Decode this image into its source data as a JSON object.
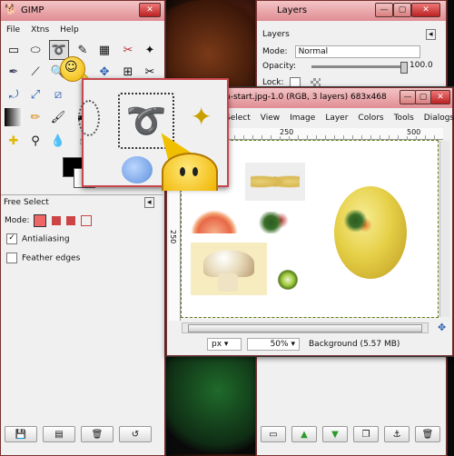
{
  "toolbox": {
    "title": "GIMP",
    "menu": [
      "File",
      "Xtns",
      "Help"
    ],
    "dock_title": "Free Select",
    "mode_label": "Mode:",
    "antialiasing_label": "Antialiasing",
    "feather_label": "Feather edges",
    "antialiasing_checked": true,
    "feather_checked": false
  },
  "layers": {
    "title": "Layers",
    "heading": "Layers",
    "mode_label": "Mode:",
    "mode_value": "Normal",
    "opacity_label": "Opacity:",
    "opacity_value": "100.0",
    "opacity_level": 1.0,
    "lock_label": "Lock:"
  },
  "image_window": {
    "title": "n-start.jpg-1.0 (RGB, 3 layers) 683x468",
    "menu": [
      "Select",
      "View",
      "Image",
      "Layer",
      "Colors",
      "Tools",
      "Dialogs"
    ],
    "ruler_h": [
      "250",
      "500"
    ],
    "ruler_v": [
      "250"
    ],
    "unit": "px",
    "zoom": "50%",
    "status": "Background (5.57 MB)"
  },
  "colors": {
    "accent": "#c8464e",
    "titlebar": "#e9a3a8"
  }
}
